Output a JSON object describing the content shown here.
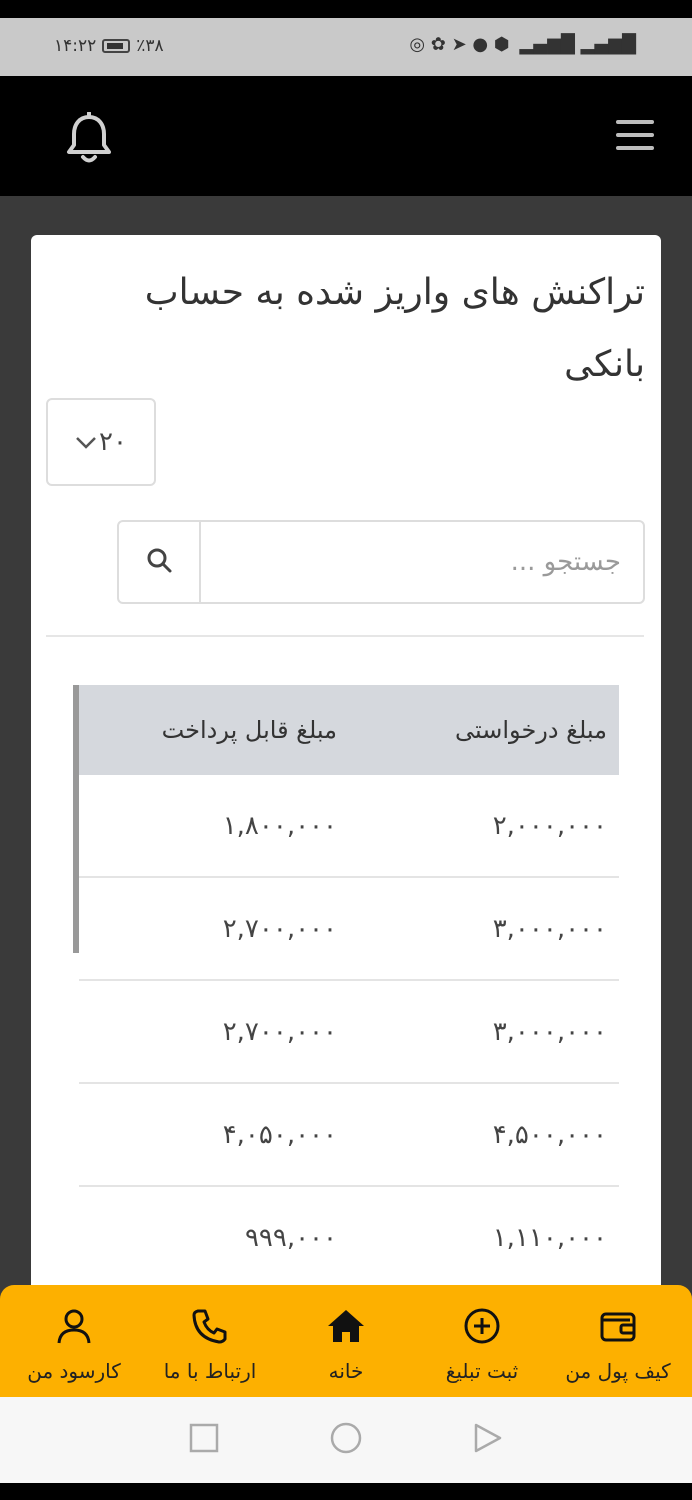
{
  "status_bar": {
    "time": "۱۴:۲۲",
    "battery": "٪۳۸"
  },
  "page": {
    "title": "تراکنش های واریز شده به حساب بانکی",
    "page_size": "۲۰",
    "search_placeholder": "جستجو ..."
  },
  "table": {
    "headers": {
      "requested": "مبلغ درخواستی",
      "payable": "مبلغ قابل پرداخت"
    },
    "rows": [
      {
        "requested": "۲,۰۰۰,۰۰۰",
        "payable": "۱,۸۰۰,۰۰۰"
      },
      {
        "requested": "۳,۰۰۰,۰۰۰",
        "payable": "۲,۷۰۰,۰۰۰"
      },
      {
        "requested": "۳,۰۰۰,۰۰۰",
        "payable": "۲,۷۰۰,۰۰۰"
      },
      {
        "requested": "۴,۵۰۰,۰۰۰",
        "payable": "۴,۰۵۰,۰۰۰"
      },
      {
        "requested": "۱,۱۱۰,۰۰۰",
        "payable": "۹۹۹,۰۰۰"
      }
    ]
  },
  "bottom_nav": {
    "items": [
      {
        "label": "کیف پول من",
        "icon": "wallet-icon"
      },
      {
        "label": "ثبت تبلیغ",
        "icon": "plus-circle-icon"
      },
      {
        "label": "خانه",
        "icon": "home-icon"
      },
      {
        "label": "ارتباط با ما",
        "icon": "phone-icon"
      },
      {
        "label": "کارسود من",
        "icon": "user-icon"
      }
    ]
  },
  "colors": {
    "accent": "#fdb000",
    "header_bg": "#000000",
    "table_header_bg": "#d5d8dd"
  }
}
